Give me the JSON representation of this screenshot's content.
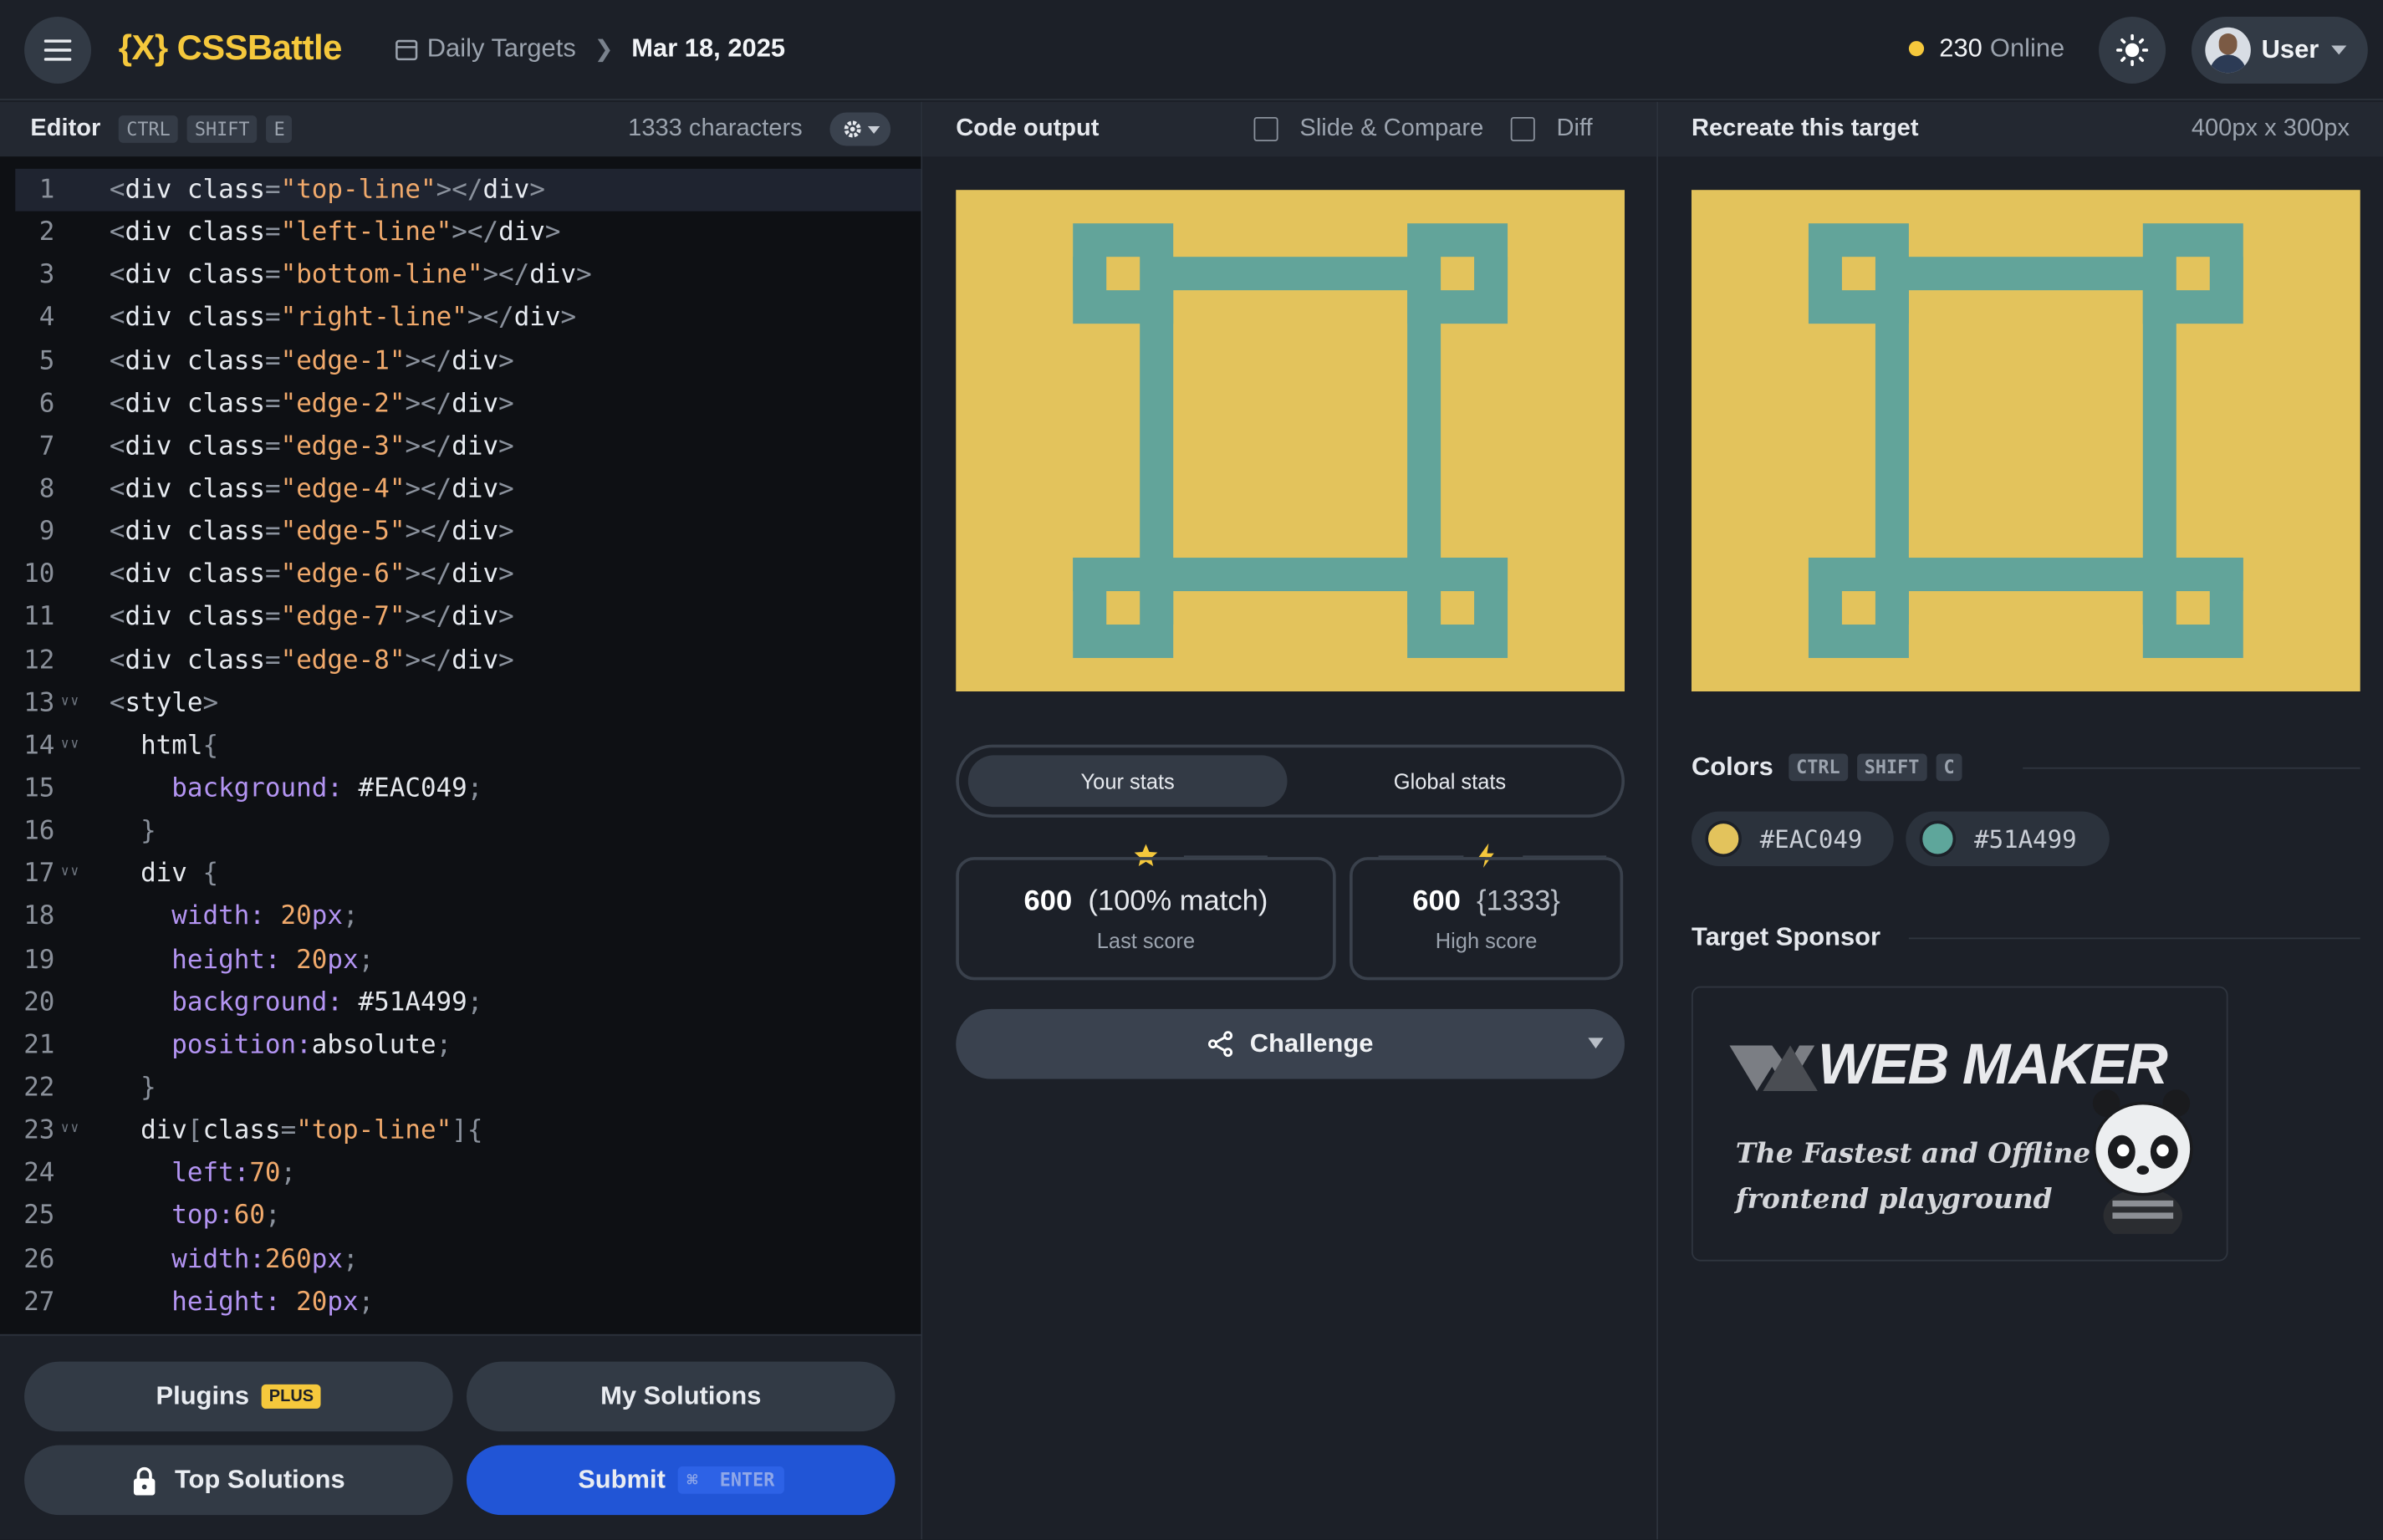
{
  "header": {
    "logo_text": "{X} CSSBattle",
    "breadcrumb_link": "Daily Targets",
    "breadcrumb_date": "Mar 18, 2025",
    "online_count": "230",
    "online_label": "Online",
    "user_label": "User"
  },
  "editor": {
    "title": "Editor",
    "shortcut_keys": [
      "CTRL",
      "SHIFT",
      "E"
    ],
    "char_count": "1333 characters",
    "lines": [
      [
        [
          "t-p",
          "<"
        ],
        [
          "t-tag",
          "div "
        ],
        [
          "t-a",
          "class"
        ],
        [
          "t-p",
          "="
        ],
        [
          "t-s",
          "\"top-line\""
        ],
        [
          "t-p",
          "></"
        ],
        [
          "t-tag",
          "div"
        ],
        [
          "t-p",
          ">"
        ]
      ],
      [
        [
          "t-p",
          "<"
        ],
        [
          "t-tag",
          "div "
        ],
        [
          "t-a",
          "class"
        ],
        [
          "t-p",
          "="
        ],
        [
          "t-s",
          "\"left-line\""
        ],
        [
          "t-p",
          "></"
        ],
        [
          "t-tag",
          "div"
        ],
        [
          "t-p",
          ">"
        ]
      ],
      [
        [
          "t-p",
          "<"
        ],
        [
          "t-tag",
          "div "
        ],
        [
          "t-a",
          "class"
        ],
        [
          "t-p",
          "="
        ],
        [
          "t-s",
          "\"bottom-line\""
        ],
        [
          "t-p",
          "></"
        ],
        [
          "t-tag",
          "div"
        ],
        [
          "t-p",
          ">"
        ]
      ],
      [
        [
          "t-p",
          "<"
        ],
        [
          "t-tag",
          "div "
        ],
        [
          "t-a",
          "class"
        ],
        [
          "t-p",
          "="
        ],
        [
          "t-s",
          "\"right-line\""
        ],
        [
          "t-p",
          "></"
        ],
        [
          "t-tag",
          "div"
        ],
        [
          "t-p",
          ">"
        ]
      ],
      [
        [
          "t-p",
          "<"
        ],
        [
          "t-tag",
          "div "
        ],
        [
          "t-a",
          "class"
        ],
        [
          "t-p",
          "="
        ],
        [
          "t-s",
          "\"edge-1\""
        ],
        [
          "t-p",
          "></"
        ],
        [
          "t-tag",
          "div"
        ],
        [
          "t-p",
          ">"
        ]
      ],
      [
        [
          "t-p",
          "<"
        ],
        [
          "t-tag",
          "div "
        ],
        [
          "t-a",
          "class"
        ],
        [
          "t-p",
          "="
        ],
        [
          "t-s",
          "\"edge-2\""
        ],
        [
          "t-p",
          "></"
        ],
        [
          "t-tag",
          "div"
        ],
        [
          "t-p",
          ">"
        ]
      ],
      [
        [
          "t-p",
          "<"
        ],
        [
          "t-tag",
          "div "
        ],
        [
          "t-a",
          "class"
        ],
        [
          "t-p",
          "="
        ],
        [
          "t-s",
          "\"edge-3\""
        ],
        [
          "t-p",
          "></"
        ],
        [
          "t-tag",
          "div"
        ],
        [
          "t-p",
          ">"
        ]
      ],
      [
        [
          "t-p",
          "<"
        ],
        [
          "t-tag",
          "div "
        ],
        [
          "t-a",
          "class"
        ],
        [
          "t-p",
          "="
        ],
        [
          "t-s",
          "\"edge-4\""
        ],
        [
          "t-p",
          "></"
        ],
        [
          "t-tag",
          "div"
        ],
        [
          "t-p",
          ">"
        ]
      ],
      [
        [
          "t-p",
          "<"
        ],
        [
          "t-tag",
          "div "
        ],
        [
          "t-a",
          "class"
        ],
        [
          "t-p",
          "="
        ],
        [
          "t-s",
          "\"edge-5\""
        ],
        [
          "t-p",
          "></"
        ],
        [
          "t-tag",
          "div"
        ],
        [
          "t-p",
          ">"
        ]
      ],
      [
        [
          "t-p",
          "<"
        ],
        [
          "t-tag",
          "div "
        ],
        [
          "t-a",
          "class"
        ],
        [
          "t-p",
          "="
        ],
        [
          "t-s",
          "\"edge-6\""
        ],
        [
          "t-p",
          "></"
        ],
        [
          "t-tag",
          "div"
        ],
        [
          "t-p",
          ">"
        ]
      ],
      [
        [
          "t-p",
          "<"
        ],
        [
          "t-tag",
          "div "
        ],
        [
          "t-a",
          "class"
        ],
        [
          "t-p",
          "="
        ],
        [
          "t-s",
          "\"edge-7\""
        ],
        [
          "t-p",
          "></"
        ],
        [
          "t-tag",
          "div"
        ],
        [
          "t-p",
          ">"
        ]
      ],
      [
        [
          "t-p",
          "<"
        ],
        [
          "t-tag",
          "div "
        ],
        [
          "t-a",
          "class"
        ],
        [
          "t-p",
          "="
        ],
        [
          "t-s",
          "\"edge-8\""
        ],
        [
          "t-p",
          "></"
        ],
        [
          "t-tag",
          "div"
        ],
        [
          "t-p",
          ">"
        ]
      ],
      [
        [
          "t-p",
          "<"
        ],
        [
          "t-tag",
          "style"
        ],
        [
          "t-p",
          ">"
        ]
      ],
      [
        [
          "t-v",
          "  html"
        ],
        [
          "t-p",
          "{"
        ]
      ],
      [
        [
          "t-k",
          "    background: "
        ],
        [
          "t-v",
          "#EAC049"
        ],
        [
          "t-p",
          ";"
        ]
      ],
      [
        [
          "t-p",
          "  }"
        ]
      ],
      [
        [
          "t-v",
          "  div "
        ],
        [
          "t-p",
          "{"
        ]
      ],
      [
        [
          "t-k",
          "    width: "
        ],
        [
          "t-n",
          "20"
        ],
        [
          "t-k",
          "px"
        ],
        [
          "t-p",
          ";"
        ]
      ],
      [
        [
          "t-k",
          "    height: "
        ],
        [
          "t-n",
          "20"
        ],
        [
          "t-k",
          "px"
        ],
        [
          "t-p",
          ";"
        ]
      ],
      [
        [
          "t-k",
          "    background: "
        ],
        [
          "t-v",
          "#51A499"
        ],
        [
          "t-p",
          ";"
        ]
      ],
      [
        [
          "t-k",
          "    position:"
        ],
        [
          "t-v",
          "absolute"
        ],
        [
          "t-p",
          ";"
        ]
      ],
      [
        [
          "t-p",
          "  }"
        ]
      ],
      [
        [
          "t-v",
          "  div"
        ],
        [
          "t-p",
          "["
        ],
        [
          "t-a",
          "class"
        ],
        [
          "t-p",
          "="
        ],
        [
          "t-s",
          "\"top-line\""
        ],
        [
          "t-p",
          "]{"
        ]
      ],
      [
        [
          "t-k",
          "    left:"
        ],
        [
          "t-n",
          "70"
        ],
        [
          "t-p",
          ";"
        ]
      ],
      [
        [
          "t-k",
          "    top:"
        ],
        [
          "t-n",
          "60"
        ],
        [
          "t-p",
          ";"
        ]
      ],
      [
        [
          "t-k",
          "    width:"
        ],
        [
          "t-n",
          "260"
        ],
        [
          "t-k",
          "px"
        ],
        [
          "t-p",
          ";"
        ]
      ],
      [
        [
          "t-k",
          "    height: "
        ],
        [
          "t-n",
          "20"
        ],
        [
          "t-k",
          "px"
        ],
        [
          "t-p",
          ";"
        ]
      ]
    ],
    "fold_lines": [
      13,
      14,
      17,
      23
    ]
  },
  "footer_buttons": {
    "plugins": "Plugins",
    "plus_badge": "PLUS",
    "my_solutions": "My Solutions",
    "top_solutions": "Top Solutions",
    "submit": "Submit",
    "submit_shortcut": "ENTER"
  },
  "output": {
    "title": "Code output",
    "slide_compare": "Slide & Compare",
    "diff": "Diff"
  },
  "stats": {
    "tab_your": "Your stats",
    "tab_global": "Global stats",
    "last_score_value": "600",
    "last_score_match": "(100% match)",
    "last_score_label": "Last score",
    "high_score_value": "600",
    "high_score_chars": "{1333}",
    "high_score_label": "High score",
    "challenge": "Challenge"
  },
  "target": {
    "title": "Recreate this target",
    "size": "400px x 300px",
    "colors_title": "Colors",
    "colors_shortcut": [
      "CTRL",
      "SHIFT",
      "C"
    ],
    "colors": [
      {
        "hex": "#EAC049",
        "swatch": "#e3c35c"
      },
      {
        "hex": "#51A499",
        "swatch": "#5ea69b"
      }
    ],
    "sponsor_title": "Target Sponsor",
    "sponsor_name": "WEB MAKER",
    "sponsor_tagline": "The Fastest and Offline frontend playground"
  },
  "colors": {
    "accent_yellow": "#f5c83c",
    "submit_blue": "#2155d6",
    "target_bg": "#e3c35c",
    "target_shape": "#62a49a"
  }
}
